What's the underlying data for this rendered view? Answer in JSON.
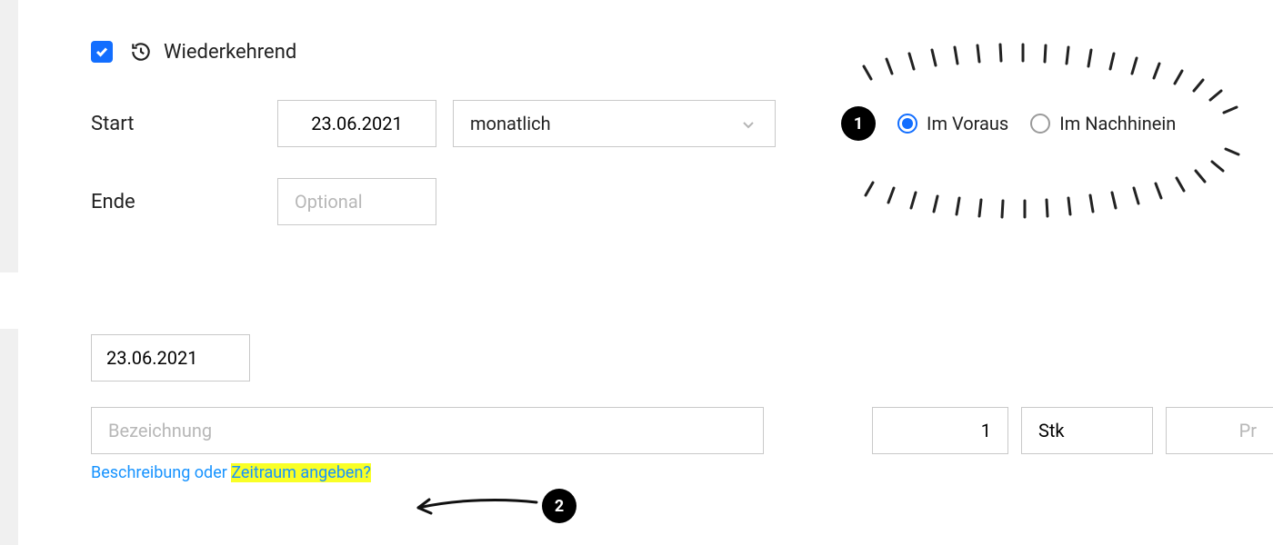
{
  "recurring": {
    "checked": true,
    "label": "Wiederkehrend",
    "start_label": "Start",
    "start_date": "23.06.2021",
    "frequency": "monatlich",
    "end_label": "Ende",
    "end_placeholder": "Optional"
  },
  "payment_timing": {
    "advance_label": "Im Voraus",
    "retro_label": "Im Nachhinein",
    "selected": "advance"
  },
  "callouts": {
    "one": "1",
    "two": "2"
  },
  "line_item": {
    "date": "23.06.2021",
    "description_placeholder": "Bezeichnung",
    "quantity": "1",
    "unit": "Stk",
    "price_placeholder": "Pr"
  },
  "link": {
    "part1": "Beschreibung oder ",
    "part2": "Zeitraum angeben?"
  }
}
